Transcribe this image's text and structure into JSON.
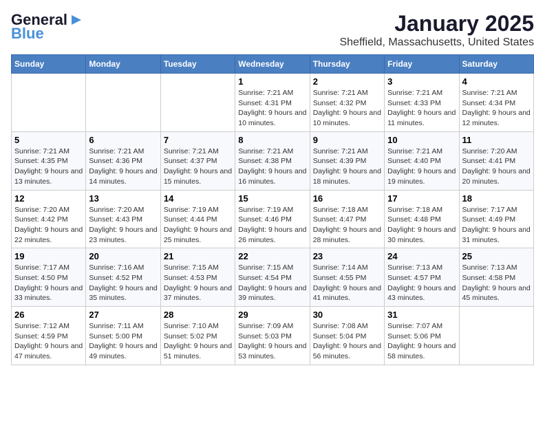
{
  "logo": {
    "line1": "General",
    "line2": "Blue"
  },
  "title": "January 2025",
  "subtitle": "Sheffield, Massachusetts, United States",
  "days": [
    "Sunday",
    "Monday",
    "Tuesday",
    "Wednesday",
    "Thursday",
    "Friday",
    "Saturday"
  ],
  "weeks": [
    [
      {
        "num": "",
        "content": ""
      },
      {
        "num": "",
        "content": ""
      },
      {
        "num": "",
        "content": ""
      },
      {
        "num": "1",
        "content": "Sunrise: 7:21 AM\nSunset: 4:31 PM\nDaylight: 9 hours and 10 minutes."
      },
      {
        "num": "2",
        "content": "Sunrise: 7:21 AM\nSunset: 4:32 PM\nDaylight: 9 hours and 10 minutes."
      },
      {
        "num": "3",
        "content": "Sunrise: 7:21 AM\nSunset: 4:33 PM\nDaylight: 9 hours and 11 minutes."
      },
      {
        "num": "4",
        "content": "Sunrise: 7:21 AM\nSunset: 4:34 PM\nDaylight: 9 hours and 12 minutes."
      }
    ],
    [
      {
        "num": "5",
        "content": "Sunrise: 7:21 AM\nSunset: 4:35 PM\nDaylight: 9 hours and 13 minutes."
      },
      {
        "num": "6",
        "content": "Sunrise: 7:21 AM\nSunset: 4:36 PM\nDaylight: 9 hours and 14 minutes."
      },
      {
        "num": "7",
        "content": "Sunrise: 7:21 AM\nSunset: 4:37 PM\nDaylight: 9 hours and 15 minutes."
      },
      {
        "num": "8",
        "content": "Sunrise: 7:21 AM\nSunset: 4:38 PM\nDaylight: 9 hours and 16 minutes."
      },
      {
        "num": "9",
        "content": "Sunrise: 7:21 AM\nSunset: 4:39 PM\nDaylight: 9 hours and 18 minutes."
      },
      {
        "num": "10",
        "content": "Sunrise: 7:21 AM\nSunset: 4:40 PM\nDaylight: 9 hours and 19 minutes."
      },
      {
        "num": "11",
        "content": "Sunrise: 7:20 AM\nSunset: 4:41 PM\nDaylight: 9 hours and 20 minutes."
      }
    ],
    [
      {
        "num": "12",
        "content": "Sunrise: 7:20 AM\nSunset: 4:42 PM\nDaylight: 9 hours and 22 minutes."
      },
      {
        "num": "13",
        "content": "Sunrise: 7:20 AM\nSunset: 4:43 PM\nDaylight: 9 hours and 23 minutes."
      },
      {
        "num": "14",
        "content": "Sunrise: 7:19 AM\nSunset: 4:44 PM\nDaylight: 9 hours and 25 minutes."
      },
      {
        "num": "15",
        "content": "Sunrise: 7:19 AM\nSunset: 4:46 PM\nDaylight: 9 hours and 26 minutes."
      },
      {
        "num": "16",
        "content": "Sunrise: 7:18 AM\nSunset: 4:47 PM\nDaylight: 9 hours and 28 minutes."
      },
      {
        "num": "17",
        "content": "Sunrise: 7:18 AM\nSunset: 4:48 PM\nDaylight: 9 hours and 30 minutes."
      },
      {
        "num": "18",
        "content": "Sunrise: 7:17 AM\nSunset: 4:49 PM\nDaylight: 9 hours and 31 minutes."
      }
    ],
    [
      {
        "num": "19",
        "content": "Sunrise: 7:17 AM\nSunset: 4:50 PM\nDaylight: 9 hours and 33 minutes."
      },
      {
        "num": "20",
        "content": "Sunrise: 7:16 AM\nSunset: 4:52 PM\nDaylight: 9 hours and 35 minutes."
      },
      {
        "num": "21",
        "content": "Sunrise: 7:15 AM\nSunset: 4:53 PM\nDaylight: 9 hours and 37 minutes."
      },
      {
        "num": "22",
        "content": "Sunrise: 7:15 AM\nSunset: 4:54 PM\nDaylight: 9 hours and 39 minutes."
      },
      {
        "num": "23",
        "content": "Sunrise: 7:14 AM\nSunset: 4:55 PM\nDaylight: 9 hours and 41 minutes."
      },
      {
        "num": "24",
        "content": "Sunrise: 7:13 AM\nSunset: 4:57 PM\nDaylight: 9 hours and 43 minutes."
      },
      {
        "num": "25",
        "content": "Sunrise: 7:13 AM\nSunset: 4:58 PM\nDaylight: 9 hours and 45 minutes."
      }
    ],
    [
      {
        "num": "26",
        "content": "Sunrise: 7:12 AM\nSunset: 4:59 PM\nDaylight: 9 hours and 47 minutes."
      },
      {
        "num": "27",
        "content": "Sunrise: 7:11 AM\nSunset: 5:00 PM\nDaylight: 9 hours and 49 minutes."
      },
      {
        "num": "28",
        "content": "Sunrise: 7:10 AM\nSunset: 5:02 PM\nDaylight: 9 hours and 51 minutes."
      },
      {
        "num": "29",
        "content": "Sunrise: 7:09 AM\nSunset: 5:03 PM\nDaylight: 9 hours and 53 minutes."
      },
      {
        "num": "30",
        "content": "Sunrise: 7:08 AM\nSunset: 5:04 PM\nDaylight: 9 hours and 56 minutes."
      },
      {
        "num": "31",
        "content": "Sunrise: 7:07 AM\nSunset: 5:06 PM\nDaylight: 9 hours and 58 minutes."
      },
      {
        "num": "",
        "content": ""
      }
    ]
  ]
}
